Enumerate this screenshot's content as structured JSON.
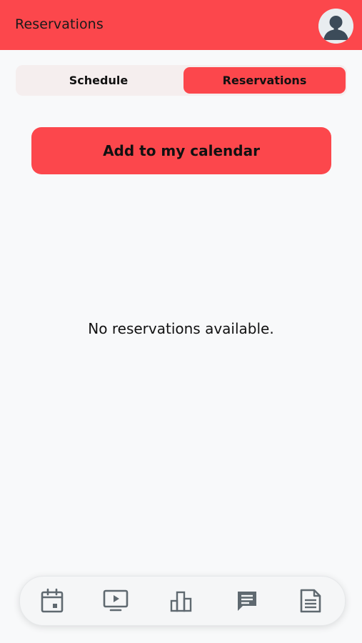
{
  "header": {
    "title": "Reservations",
    "background": "#fc474c",
    "avatar_icon": "user-avatar-icon"
  },
  "tabs": [
    {
      "label": "Schedule",
      "selected": false
    },
    {
      "label": "Reservations",
      "selected": true
    }
  ],
  "actions": {
    "add_calendar_label": "Add to my calendar"
  },
  "empty_state": {
    "message": "No reservations available."
  },
  "bottom_nav": [
    {
      "icon": "calendar-icon"
    },
    {
      "icon": "video-play-icon"
    },
    {
      "icon": "bar-chart-icon"
    },
    {
      "icon": "chat-icon"
    },
    {
      "icon": "document-icon"
    }
  ],
  "colors": {
    "accent": "#fc474c",
    "icon": "#5f6970",
    "background": "#f8f9fa"
  }
}
